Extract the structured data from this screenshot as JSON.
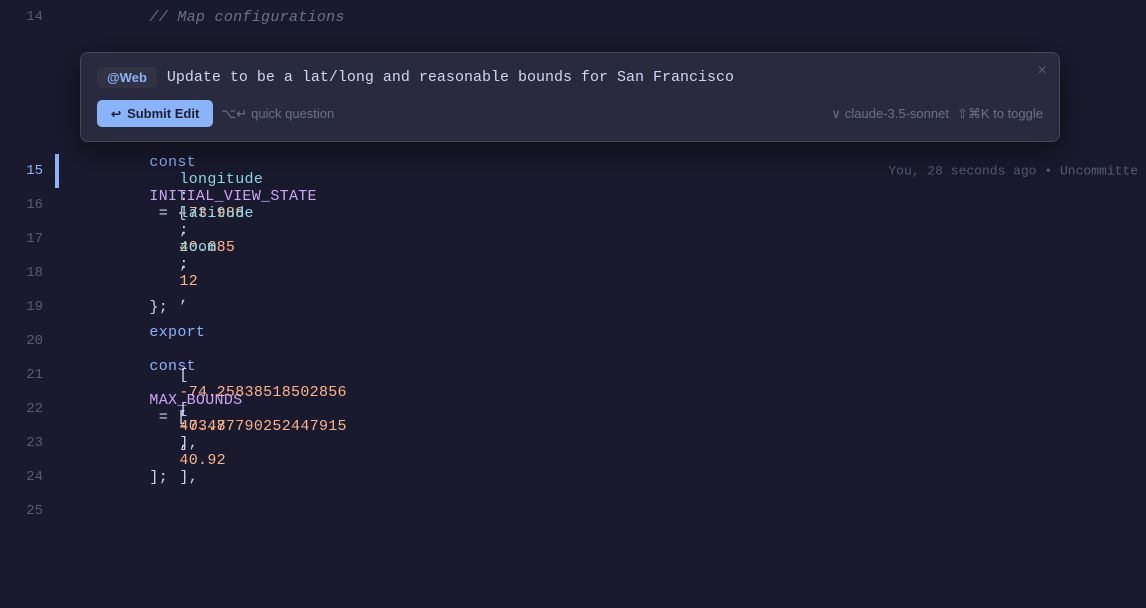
{
  "editor": {
    "background": "#1a1a2e",
    "lines": [
      {
        "number": "14",
        "active": false,
        "content": "// Map configurations",
        "type": "comment"
      },
      {
        "number": "15",
        "active": true,
        "content_parts": [
          {
            "text": "export",
            "class": "kw-export"
          },
          {
            "text": " ",
            "class": ""
          },
          {
            "text": "const",
            "class": "kw-const"
          },
          {
            "text": " ",
            "class": ""
          },
          {
            "text": "INITIAL_VIEW_STATE",
            "class": "kw-var-name"
          },
          {
            "text": " = {",
            "class": "kw-punctuation"
          }
        ],
        "annotation": "You, 28 seconds ago • Uncommitte"
      },
      {
        "number": "16",
        "content_parts": [
          {
            "text": "longitude",
            "class": "kw-key"
          },
          {
            "text": ": ",
            "class": "kw-punctuation"
          },
          {
            "text": "-73.988",
            "class": "kw-number"
          },
          {
            "text": ",",
            "class": "kw-punctuation"
          }
        ],
        "indent": 1
      },
      {
        "number": "17",
        "content_parts": [
          {
            "text": "latitude",
            "class": "kw-key"
          },
          {
            "text": ": ",
            "class": "kw-punctuation"
          },
          {
            "text": "40.685",
            "class": "kw-number"
          },
          {
            "text": ",",
            "class": "kw-punctuation"
          }
        ],
        "indent": 1
      },
      {
        "number": "18",
        "content_parts": [
          {
            "text": "zoom",
            "class": "kw-key"
          },
          {
            "text": ": ",
            "class": "kw-punctuation"
          },
          {
            "text": "12",
            "class": "kw-number"
          },
          {
            "text": ",",
            "class": "kw-punctuation"
          }
        ],
        "indent": 1
      },
      {
        "number": "19",
        "content_parts": [
          {
            "text": "};",
            "class": "kw-punctuation"
          }
        ]
      },
      {
        "number": "20",
        "content_parts": []
      },
      {
        "number": "21",
        "content_parts": [
          {
            "text": "export",
            "class": "kw-export"
          },
          {
            "text": " ",
            "class": ""
          },
          {
            "text": "const",
            "class": "kw-const"
          },
          {
            "text": " ",
            "class": ""
          },
          {
            "text": "MAX_BOUNDS",
            "class": "kw-var-name"
          },
          {
            "text": " = [",
            "class": "kw-punctuation"
          }
        ]
      },
      {
        "number": "22",
        "content_parts": [
          {
            "text": "[",
            "class": "kw-array-bracket"
          },
          {
            "text": "-74.25838518502856",
            "class": "kw-number"
          },
          {
            "text": ", ",
            "class": "kw-punctuation"
          },
          {
            "text": "40.487790252447915",
            "class": "kw-number"
          },
          {
            "text": "],",
            "class": "kw-array-bracket"
          }
        ],
        "indent": 1
      },
      {
        "number": "23",
        "content_parts": [
          {
            "text": "[",
            "class": "kw-array-bracket"
          },
          {
            "text": "-73.7",
            "class": "kw-number"
          },
          {
            "text": ", ",
            "class": "kw-punctuation"
          },
          {
            "text": "40.92",
            "class": "kw-number"
          },
          {
            "text": "],",
            "class": "kw-array-bracket"
          }
        ],
        "indent": 1
      },
      {
        "number": "24",
        "content_parts": [
          {
            "text": "];",
            "class": "kw-punctuation"
          }
        ]
      },
      {
        "number": "25",
        "content_parts": []
      }
    ]
  },
  "popup": {
    "web_badge": "@Web",
    "input_value": "Update to be a lat/long and reasonable bounds for San Francisco",
    "submit_label": "Submit Edit",
    "quick_question_label": "quick question",
    "quick_question_shortcut": "⌥↵",
    "model_label": "claude-3.5-sonnet",
    "toggle_shortcut": "⇧⌘K to toggle",
    "close_icon": "×",
    "chevron": "∨"
  },
  "git": {
    "annotation": "You, 28 seconds ago • Uncommitte"
  }
}
